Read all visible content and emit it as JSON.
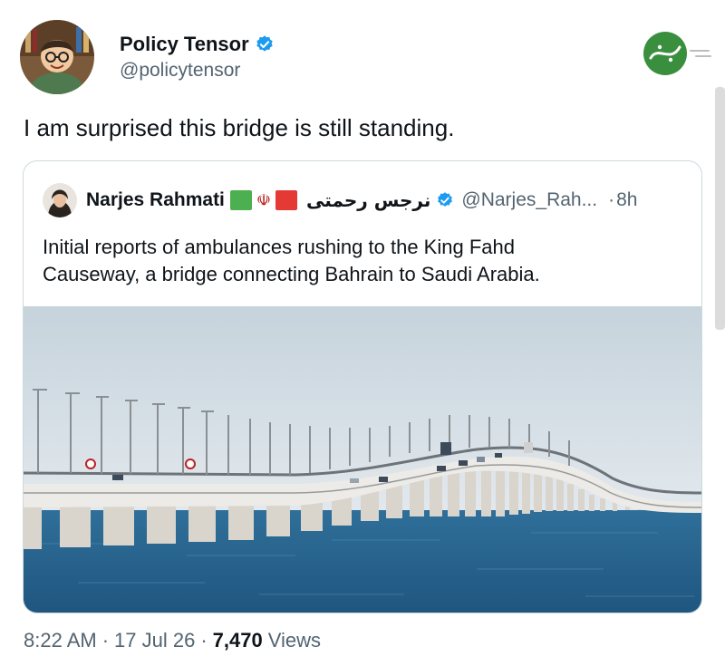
{
  "author": {
    "display_name": "Policy Tensor",
    "handle": "@policytensor",
    "verified_icon": "verified-badge-icon"
  },
  "tweet": {
    "text": "I am surprised this bridge is still standing."
  },
  "quoted": {
    "display_name": "Narjes Rahmati",
    "flag_emblem": "☫",
    "arabic_name": "نرجس رحمتی",
    "handle": "@Narjes_Rah...",
    "time_sep": "·",
    "time": "8h",
    "text_line1": "Initial reports of ambulances rushing to the King Fahd",
    "text_line2": "Causeway, a bridge connecting Bahrain to Saudi Arabia."
  },
  "footer": {
    "time": "8:22 AM",
    "date": "17 Jul 26",
    "views_count": "7,470",
    "views_label": "Views",
    "sep": "·"
  },
  "colors": {
    "accent": "#1d9bf0",
    "text": "#0f1419",
    "muted": "#536471",
    "border": "#cfd9de",
    "watermark": "#3a8f3f"
  }
}
